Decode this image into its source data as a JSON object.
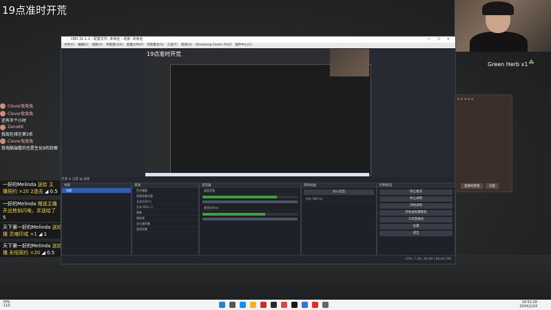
{
  "stream": {
    "title": "19点准时开荒"
  },
  "game": {
    "item_label": "Green Herb x1"
  },
  "chat": [
    {
      "name": "Clover兔兔兔",
      "text": ""
    },
    {
      "name": "Clover兔兔兔",
      "text": "还有半个小时"
    },
    {
      "name": "ZenoKK",
      "text": ""
    },
    {
      "name": "",
      "text": "我现在排在第3名"
    },
    {
      "name": "Clover兔兔兔",
      "text": "我电脑端看的也是生化9的封面"
    }
  ],
  "gifts": [
    {
      "user": "一好的Melinda",
      "action": "送给 主",
      "item": "播契约 ×20 2连击",
      "extra": "0.5"
    },
    {
      "user": "一好的Melinda",
      "action": "赠送主播",
      "item": "开出势如闪电，并送给了",
      "extra": "5"
    },
    {
      "user": "天下第一好的Melinda",
      "action": "送给 主",
      "item": "播 灵魂印戒 ×1",
      "extra": "1"
    },
    {
      "user": "天下第一好的Melinda",
      "action": "送给 主",
      "item": "播 永恒契约 ×20",
      "extra": "0.5"
    }
  ],
  "obs": {
    "window_title": "OBS 31.1.2 - 配置文件: 未命名 - 场景: 未命名",
    "window_controls": "— ☐ ✕",
    "menu": [
      "文件(F)",
      "编辑(E)",
      "视图(V)",
      "停靠窗口(D)",
      "配置文件(P)",
      "场景集合(S)",
      "工具(T)",
      "帮助(H)",
      "Streaming Center PLUS",
      "插件中心(C)"
    ],
    "preview_title": "19点准时开荒",
    "scene_tabs": "无源  ⚙ 设置  ▤ 滤镜",
    "docks": {
      "scenes": {
        "title": "场景",
        "items": [
          "场景"
        ]
      },
      "sources": {
        "title": "来源",
        "items": [
          "色位播窗",
          "视频采集设备",
          "文本(GDI+)",
          "文本 GDI+ 2",
          "图像",
          "媒体源",
          "显示器采集",
          "游戏采集"
        ]
      },
      "mixer": {
        "title": "混音器",
        "channels": [
          {
            "name": "桌面音频",
            "level": 0.78
          },
          {
            "name": "麦克风/Aux",
            "level": 0.66
          }
        ]
      },
      "transitions": {
        "title": "转场动画",
        "type": "淡入淡出",
        "duration_label": "时长",
        "duration": "300 ms"
      },
      "controls": {
        "title": "控制按钮",
        "buttons": [
          "停止推流",
          "停止录制",
          "开始录制",
          "开始虚拟摄像机",
          "工作室模式",
          "设置",
          "退出"
        ]
      }
    },
    "status": "CPU: 7.3%, 60.00 / 60.00 FPS"
  },
  "side_panel": {
    "buttons": [
      "直播间管理",
      "设置"
    ]
  },
  "taskbar": {
    "left_text": "FPS\n110",
    "time": "16:52:20",
    "date": "2024/2/24"
  }
}
